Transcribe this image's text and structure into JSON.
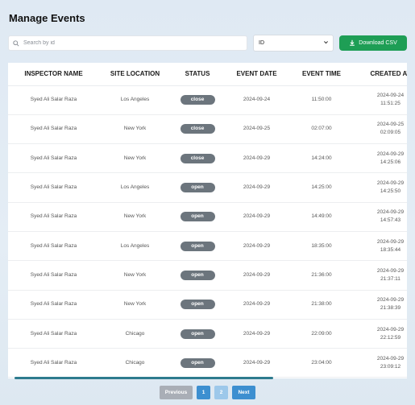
{
  "header": {
    "title": "Manage Events"
  },
  "search": {
    "placeholder": "Search by id",
    "value": ""
  },
  "filter": {
    "selected": "ID"
  },
  "download_button": {
    "label": "Download CSV"
  },
  "colors": {
    "primary": "#3d8fd0",
    "success": "#1e9e55",
    "badge": "#6c757d"
  },
  "table": {
    "columns": [
      "INSPECTOR NAME",
      "SITE LOCATION",
      "STATUS",
      "EVENT DATE",
      "EVENT TIME",
      "CREATED AT"
    ],
    "rows": [
      {
        "inspector": "Syed Ali Salar Raza",
        "site": "Los Angeles",
        "status": "close",
        "date": "2024-09-24",
        "time": "11:50:00",
        "created": "2024-09-24\n11:51:25"
      },
      {
        "inspector": "Syed Ali Salar Raza",
        "site": "New York",
        "status": "close",
        "date": "2024-09-25",
        "time": "02:07:00",
        "created": "2024-09-25\n02:09:05"
      },
      {
        "inspector": "Syed Ali Salar Raza",
        "site": "New York",
        "status": "close",
        "date": "2024-09-29",
        "time": "14:24:00",
        "created": "2024-09-29\n14:25:06"
      },
      {
        "inspector": "Syed Ali Salar Raza",
        "site": "Los Angeles",
        "status": "open",
        "date": "2024-09-29",
        "time": "14:25:00",
        "created": "2024-09-29\n14:25:50"
      },
      {
        "inspector": "Syed Ali Salar Raza",
        "site": "New York",
        "status": "open",
        "date": "2024-09-29",
        "time": "14:49:00",
        "created": "2024-09-29\n14:57:43"
      },
      {
        "inspector": "Syed Ali Salar Raza",
        "site": "Los Angeles",
        "status": "open",
        "date": "2024-09-29",
        "time": "18:35:00",
        "created": "2024-09-29\n18:35:44"
      },
      {
        "inspector": "Syed Ali Salar Raza",
        "site": "New York",
        "status": "open",
        "date": "2024-09-29",
        "time": "21:36:00",
        "created": "2024-09-29\n21:37:11"
      },
      {
        "inspector": "Syed Ali Salar Raza",
        "site": "New York",
        "status": "open",
        "date": "2024-09-29",
        "time": "21:38:00",
        "created": "2024-09-29\n21:38:39"
      },
      {
        "inspector": "Syed Ali Salar Raza",
        "site": "Chicago",
        "status": "open",
        "date": "2024-09-29",
        "time": "22:09:00",
        "created": "2024-09-29\n22:12:59"
      },
      {
        "inspector": "Syed Ali Salar Raza",
        "site": "Chicago",
        "status": "open",
        "date": "2024-09-29",
        "time": "23:04:00",
        "created": "2024-09-29\n23:09:12"
      }
    ]
  },
  "pagination": {
    "previous": "Previous",
    "pages": [
      "1",
      "2"
    ],
    "current": "1",
    "next": "Next"
  }
}
